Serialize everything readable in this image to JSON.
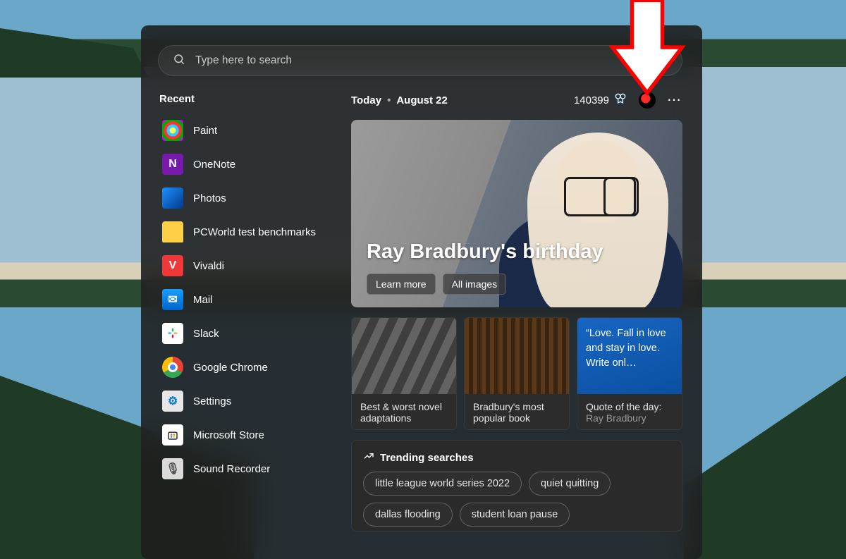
{
  "search": {
    "placeholder": "Type here to search"
  },
  "sidebar": {
    "title": "Recent",
    "items": [
      {
        "label": "Paint",
        "icon": "paint"
      },
      {
        "label": "OneNote",
        "icon": "onenote"
      },
      {
        "label": "Photos",
        "icon": "photos"
      },
      {
        "label": "PCWorld test benchmarks",
        "icon": "folder"
      },
      {
        "label": "Vivaldi",
        "icon": "vivaldi"
      },
      {
        "label": "Mail",
        "icon": "mail"
      },
      {
        "label": "Slack",
        "icon": "slack"
      },
      {
        "label": "Google Chrome",
        "icon": "chrome"
      },
      {
        "label": "Settings",
        "icon": "settings"
      },
      {
        "label": "Microsoft Store",
        "icon": "store"
      },
      {
        "label": "Sound Recorder",
        "icon": "recorder"
      }
    ]
  },
  "header": {
    "today_label": "Today",
    "date": "August 22",
    "points": "140399"
  },
  "hero": {
    "title": "Ray Bradbury's birthday",
    "learn_more": "Learn more",
    "all_images": "All images"
  },
  "cards": [
    {
      "title": "Best & worst novel adaptations",
      "sub": ""
    },
    {
      "title": "Bradbury's most popular book",
      "sub": ""
    },
    {
      "title": "Quote of the day:",
      "sub": "Ray Bradbury",
      "quote": "Love. Fall in love and stay in love. Write onl…"
    }
  ],
  "trending": {
    "title": "Trending searches",
    "items": [
      "little league world series 2022",
      "quiet quitting",
      "dallas flooding",
      "student loan pause"
    ]
  },
  "annotation": {
    "arrow_target": "user avatar"
  }
}
